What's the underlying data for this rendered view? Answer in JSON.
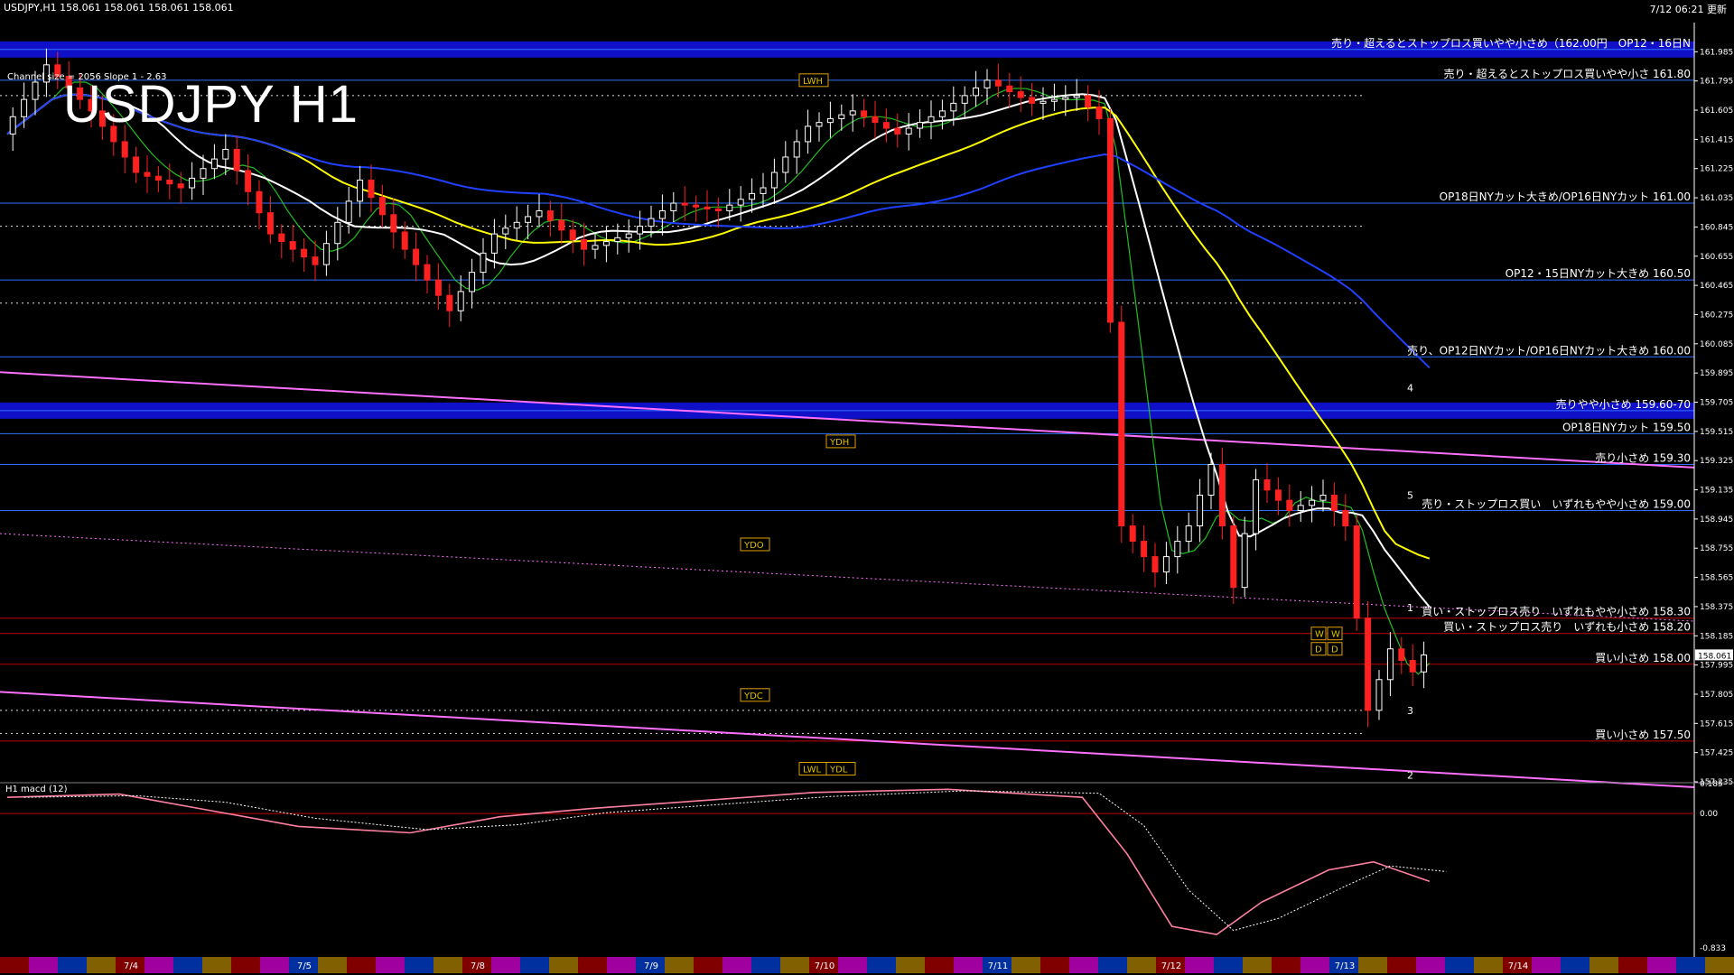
{
  "header": {
    "symbol_info": "USDJPY,H1  158.061 158.061 158.061 158.061",
    "updated": "7/12 06:21 更新"
  },
  "title": "USDJPY H1",
  "subtitle": "Channel size = 2056 Slope 1 - 2.63",
  "macd_label": "H1 macd (12)",
  "colors": {
    "background": "#000000",
    "band_blue": "#1010c8",
    "level_blue_line": "#3070ff",
    "level_red_line": "#c00000",
    "candle_up": "#ffffff",
    "candle_down": "#ff2020",
    "ma_white": "#ffffff",
    "ma_yellow": "#ffff00",
    "ma_blue": "#2040ff",
    "chikou_green": "#20c020",
    "trend_magenta": "#ff70ff",
    "channel_red": "#c00000"
  },
  "chart_data": {
    "type": "candlestick",
    "symbol": "USDJPY",
    "timeframe": "H1",
    "ylim": [
      157.235,
      162.175
    ],
    "y_ticks": [
      "161.985",
      "161.795",
      "161.605",
      "161.415",
      "161.225",
      "161.035",
      "160.845",
      "160.655",
      "160.465",
      "160.275",
      "160.085",
      "159.895",
      "159.705",
      "159.515",
      "159.325",
      "159.135",
      "158.945",
      "158.755",
      "158.565",
      "158.375",
      "158.185",
      "157.995",
      "157.805",
      "157.615",
      "157.425",
      "157.235"
    ],
    "current_price": "158.061",
    "x_ticks": [
      "7/4",
      "7/5",
      "7/8",
      "7/9",
      "7/10",
      "7/11",
      "7/12",
      "7/13",
      "7/14"
    ],
    "price_path": [
      {
        "t": 0,
        "p": 161.45
      },
      {
        "t": 4,
        "p": 161.9
      },
      {
        "t": 8,
        "p": 161.6
      },
      {
        "t": 12,
        "p": 161.2
      },
      {
        "t": 16,
        "p": 161.1
      },
      {
        "t": 20,
        "p": 161.35
      },
      {
        "t": 24,
        "p": 160.8
      },
      {
        "t": 28,
        "p": 160.6
      },
      {
        "t": 32,
        "p": 161.15
      },
      {
        "t": 36,
        "p": 160.7
      },
      {
        "t": 40,
        "p": 160.3
      },
      {
        "t": 44,
        "p": 160.8
      },
      {
        "t": 48,
        "p": 160.95
      },
      {
        "t": 52,
        "p": 160.7
      },
      {
        "t": 56,
        "p": 160.8
      },
      {
        "t": 60,
        "p": 161.0
      },
      {
        "t": 64,
        "p": 160.95
      },
      {
        "t": 68,
        "p": 161.1
      },
      {
        "t": 72,
        "p": 161.5
      },
      {
        "t": 76,
        "p": 161.6
      },
      {
        "t": 80,
        "p": 161.45
      },
      {
        "t": 84,
        "p": 161.6
      },
      {
        "t": 88,
        "p": 161.8
      },
      {
        "t": 92,
        "p": 161.65
      },
      {
        "t": 96,
        "p": 161.7
      },
      {
        "t": 98,
        "p": 161.55
      },
      {
        "t": 100,
        "p": 158.9
      },
      {
        "t": 103,
        "p": 158.6
      },
      {
        "t": 106,
        "p": 158.9
      },
      {
        "t": 108,
        "p": 159.3
      },
      {
        "t": 110,
        "p": 158.5
      },
      {
        "t": 112,
        "p": 159.2
      },
      {
        "t": 115,
        "p": 159.0
      },
      {
        "t": 118,
        "p": 159.1
      },
      {
        "t": 120,
        "p": 158.9
      },
      {
        "t": 122,
        "p": 157.7
      },
      {
        "t": 124,
        "p": 158.1
      },
      {
        "t": 126,
        "p": 157.95
      },
      {
        "t": 127,
        "p": 158.06
      }
    ],
    "annotations": [
      {
        "price": 162.0,
        "text": "売り・超えるとストップロス買いやや小さめ（162.00円　OP12・16日N",
        "band": true
      },
      {
        "price": 161.8,
        "text": "売り・超えるとストップロス買いやや小さ 161.80",
        "band": false
      },
      {
        "price": 161.0,
        "text": "OP18日NYカット大きめ/OP16日NYカット 161.00",
        "band": false
      },
      {
        "price": 160.5,
        "text": "OP12・15日NYカット大きめ 160.50",
        "band": false
      },
      {
        "price": 160.0,
        "text": "売り、OP12日NYカット/OP16日NYカット大きめ 160.00",
        "band": false
      },
      {
        "price": 159.65,
        "text": "売りやや小さめ 159.60-70",
        "band": true
      },
      {
        "price": 159.5,
        "text": "OP18日NYカット 159.50",
        "band": false
      },
      {
        "price": 159.3,
        "text": "売り小さめ 159.30",
        "band": false
      },
      {
        "price": 159.0,
        "text": "売り・ストップロス買い　いずれもやや小さめ 159.00",
        "band": false
      },
      {
        "price": 158.3,
        "text": "買い・ストップロス売り　いずれもやや小さめ 158.30",
        "band": false
      },
      {
        "price": 158.2,
        "text": "買い・ストップロス売り　いずれも小さめ 158.20",
        "band": false
      },
      {
        "price": 158.0,
        "text": "買い小さめ 158.00",
        "band": false
      },
      {
        "price": 157.5,
        "text": "買い小さめ 157.50",
        "band": false
      }
    ],
    "tags": [
      "LWH",
      "YDH",
      "YDO",
      "YDC",
      "LWL",
      "YDL",
      "W",
      "D",
      "W",
      "D"
    ],
    "wave_labels": [
      "4",
      "5",
      "1",
      "3",
      "2"
    ],
    "macd": {
      "ylim": [
        -0.833,
        0.185
      ],
      "y_ticks": [
        "0.185",
        "0.00",
        "-0.833"
      ],
      "values": [
        {
          "t": 0,
          "v": 0.1
        },
        {
          "t": 10,
          "v": 0.12
        },
        {
          "t": 18,
          "v": 0.02
        },
        {
          "t": 26,
          "v": -0.08
        },
        {
          "t": 36,
          "v": -0.12
        },
        {
          "t": 44,
          "v": -0.02
        },
        {
          "t": 52,
          "v": 0.03
        },
        {
          "t": 62,
          "v": 0.08
        },
        {
          "t": 72,
          "v": 0.13
        },
        {
          "t": 84,
          "v": 0.15
        },
        {
          "t": 96,
          "v": 0.1
        },
        {
          "t": 100,
          "v": -0.25
        },
        {
          "t": 104,
          "v": -0.7
        },
        {
          "t": 108,
          "v": -0.75
        },
        {
          "t": 112,
          "v": -0.55
        },
        {
          "t": 118,
          "v": -0.35
        },
        {
          "t": 122,
          "v": -0.3
        },
        {
          "t": 127,
          "v": -0.42
        }
      ]
    }
  }
}
